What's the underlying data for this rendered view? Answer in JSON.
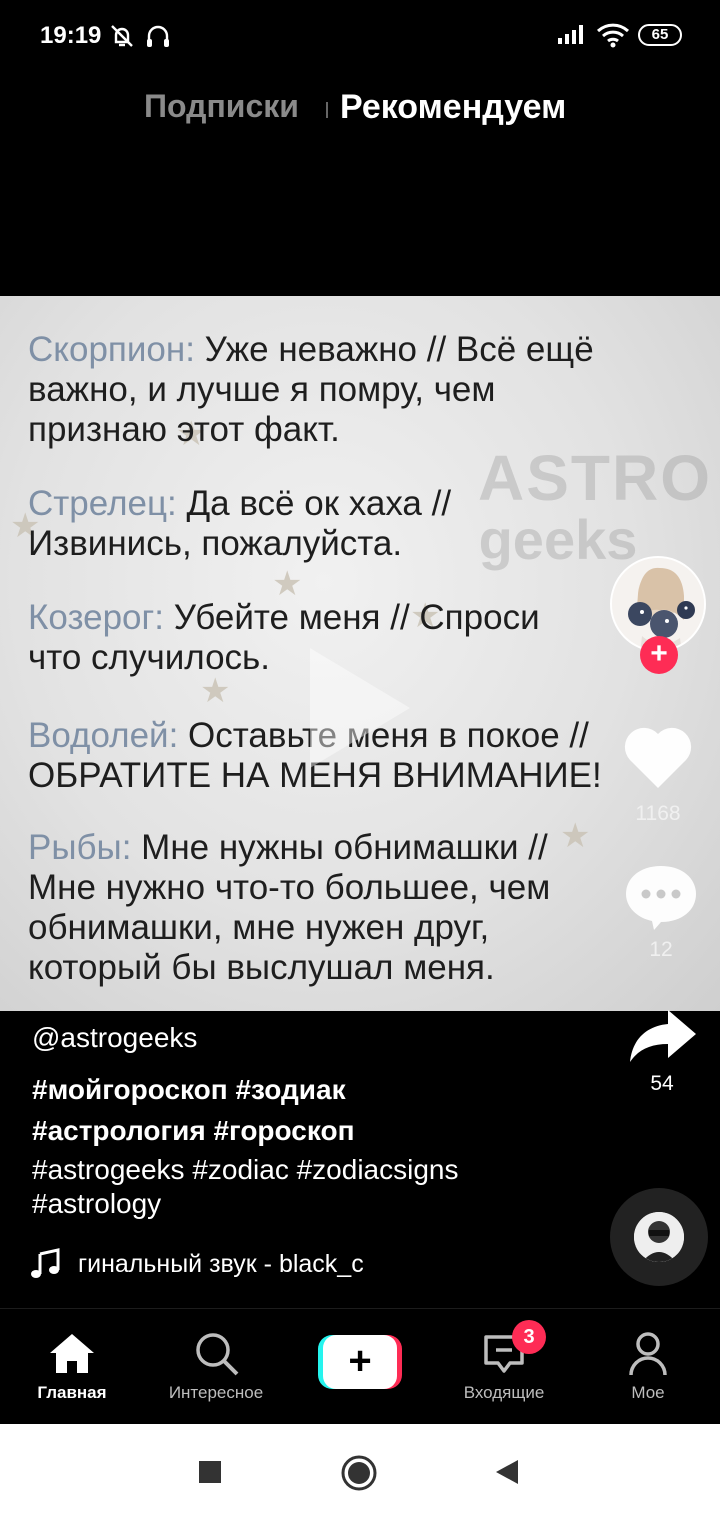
{
  "status_bar": {
    "time": "19:19",
    "battery": "65",
    "icons": [
      "alarm-off-icon",
      "headphones-icon",
      "signal-icon",
      "wifi-icon",
      "battery-icon"
    ]
  },
  "top_tabs": {
    "following": "Подписки",
    "for_you": "Рекомендуем"
  },
  "video": {
    "watermark_line1": "ASTRO",
    "watermark_line2": "geeks",
    "stanzas": [
      {
        "sign": "Скорпион:",
        "lines": [
          " Уже неважно // Всё ещё",
          "важно, и лучше я помру, чем",
          "признаю этот факт."
        ]
      },
      {
        "sign": "Стрелец:",
        "lines": [
          " Да всё ок хаха //",
          "Извинись, пожалуйста."
        ]
      },
      {
        "sign": "Козерог:",
        "lines": [
          " Убейте меня // Спроси",
          "что случилось."
        ]
      },
      {
        "sign": "Водолей:",
        "lines": [
          " Оставьте меня в покое //",
          "ОБРАТИТЕ НА МЕНЯ ВНИМАНИЕ!"
        ]
      },
      {
        "sign": "Рыбы:",
        "lines": [
          " Мне нужны обнимашки //",
          "Мне нужно что-то большее, чем",
          "обнимашки, мне нужен друг,",
          "который бы выслушал меня."
        ]
      }
    ]
  },
  "rail": {
    "likes": "1168",
    "comments": "12",
    "shares": "54",
    "follow_plus": "+"
  },
  "caption": {
    "author": "@astrogeeks",
    "tags_line1": "#мойгороскоп #зодиак",
    "tags_line2": "#астрология #гороскоп",
    "tags_line3": "#astrogeeks #zodiac #zodiacsigns",
    "tags_line4": "#astrology",
    "music": "гинальный звук - black_c"
  },
  "bottom_nav": {
    "home": "Главная",
    "discover": "Интересное",
    "create": "+",
    "inbox": "Входящие",
    "inbox_badge": "3",
    "profile": "Мое"
  },
  "colors": {
    "accent_red": "#fe2c55",
    "accent_cyan": "#25f4ee",
    "sign_blue_gray": "#7f90a6"
  }
}
